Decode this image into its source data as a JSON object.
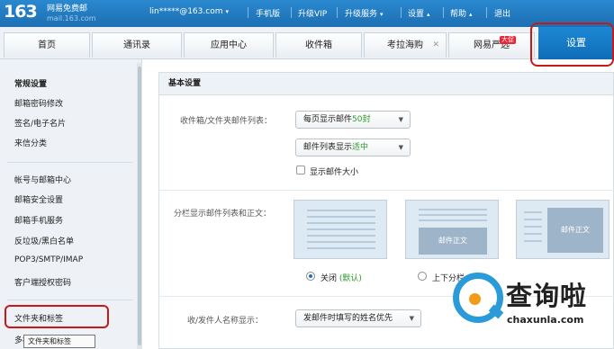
{
  "topbar": {
    "logo": "163",
    "logo_text": "网易免费邮",
    "logo_sub": "mail.163.com",
    "account": "lin*****@163.com",
    "items": [
      "手机版",
      "升级VIP",
      "升级服务",
      "设置",
      "帮助",
      "退出"
    ]
  },
  "nav": {
    "tabs": [
      "首页",
      "通讯录",
      "应用中心",
      "收件箱",
      "考拉海购",
      "网易严选"
    ],
    "new_badge": "大促",
    "settings": "设置"
  },
  "sidebar": {
    "group1": [
      "常规设置",
      "邮箱密码修改",
      "签名/电子名片",
      "来信分类"
    ],
    "group2": [
      "帐号与邮箱中心",
      "邮箱安全设置",
      "邮箱手机服务",
      "反垃圾/黑白名单",
      "POP3/SMTP/IMAP",
      "客户端授权密码"
    ],
    "group3": [
      "文件夹和标签",
      "多标"
    ],
    "tooltip": "文件夹和标签"
  },
  "main": {
    "section_title": "基本设置",
    "list_label": "收件箱/文件夹邮件列表：",
    "per_page_prefix": "每页显示邮件",
    "per_page_value": "50封",
    "list_display_prefix": "邮件列表显示",
    "list_display_value": "适中",
    "show_size_label": "显示邮件大小",
    "split_label": "分栏显示邮件列表和正文：",
    "preview_body_label": "邮件正文",
    "radio_off_label": "关闭",
    "radio_off_default": "(默认)",
    "radio_topbottom_label": "上下分栏",
    "name_label": "收/发件人名称显示：",
    "name_select": "发邮件时填写的姓名优先"
  },
  "watermark": {
    "text": "查询啦",
    "sub": "chaxunla.com"
  },
  "colors": {
    "topbar": "#1c6fb3",
    "settings_tab": "#0f6db8",
    "highlight_ring": "#c81818",
    "green_value": "#2a9a2a",
    "watermark_blue": "#2a9ad8",
    "watermark_orange": "#f29a1a"
  },
  "icons": [
    "chevron-down-icon",
    "close-icon",
    "checkbox-icon",
    "radio-icon"
  ]
}
